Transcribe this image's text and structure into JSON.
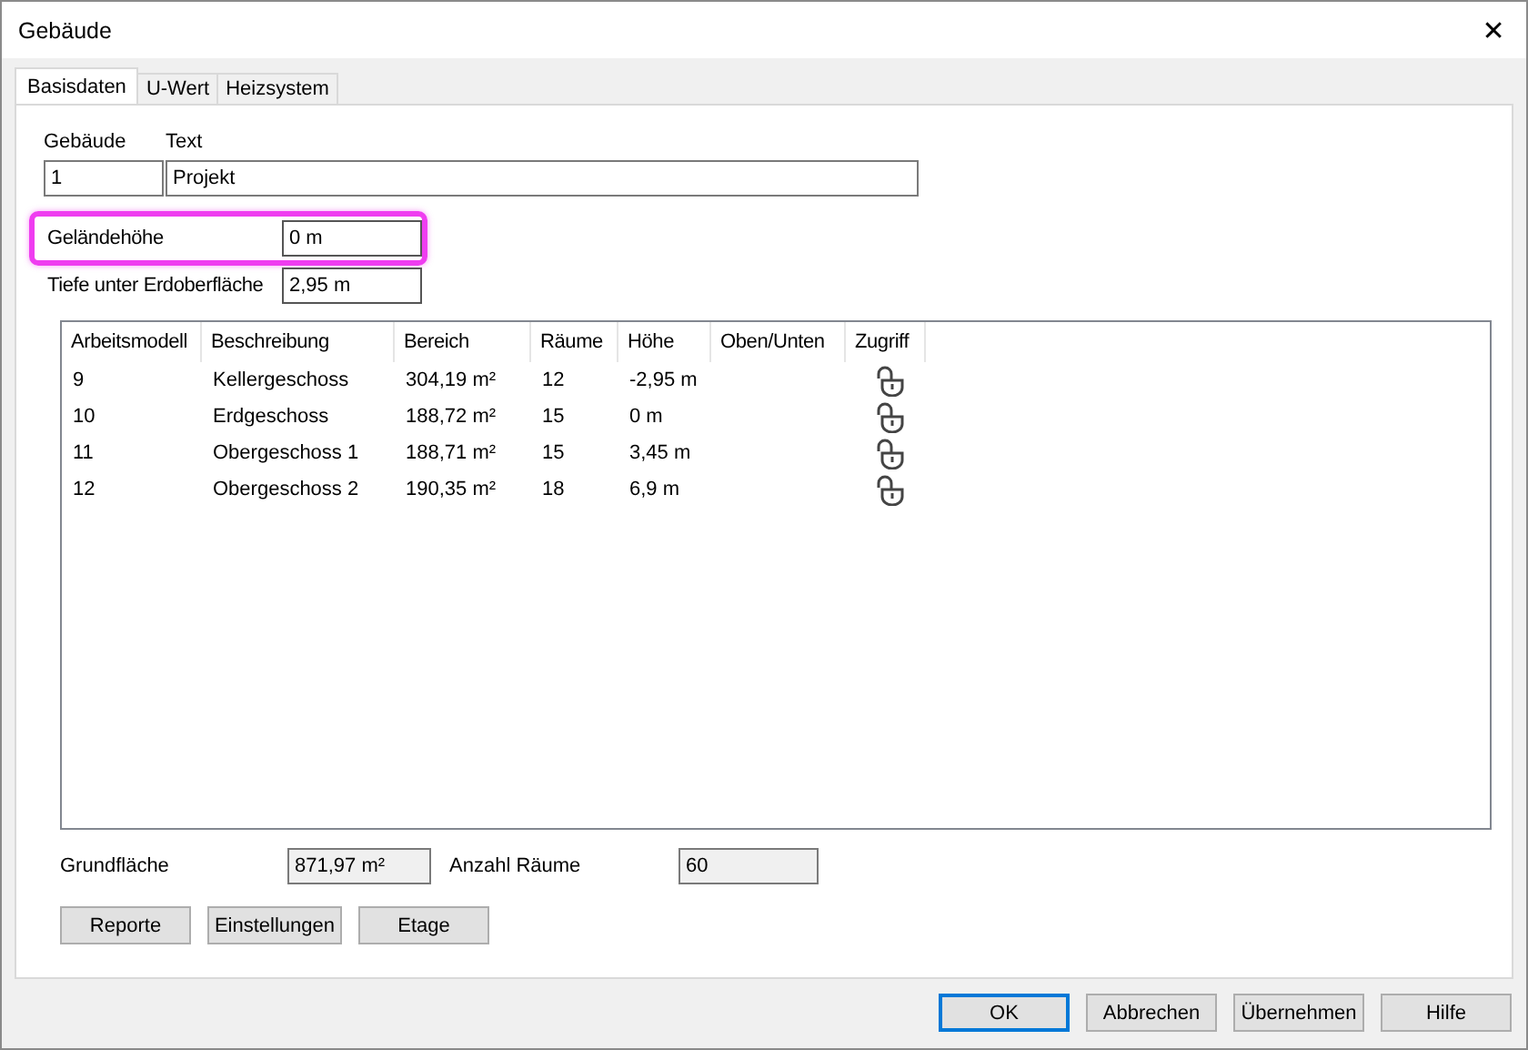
{
  "window": {
    "title": "Gebäude",
    "close": "✕"
  },
  "tabs": [
    {
      "label": "Basisdaten",
      "selected": true
    },
    {
      "label": "U-Wert",
      "selected": false
    },
    {
      "label": "Heizsystem",
      "selected": false
    }
  ],
  "building": {
    "number_label": "Gebäude",
    "number": "1",
    "text_label": "Text",
    "text": "Projekt"
  },
  "terrain_height": {
    "label": "Geländehöhe",
    "value": "0 m",
    "highlighted": true
  },
  "depth": {
    "label": "Tiefe unter Erdoberfläche",
    "value": "2,95 m"
  },
  "table": {
    "columns": [
      "Arbeitsmodell",
      "Beschreibung",
      "Bereich",
      "Räume",
      "Höhe",
      "Oben/Unten",
      "Zugriff"
    ],
    "rows": [
      {
        "model": "9",
        "description": "Kellergeschoss",
        "area": "304,19 m²",
        "rooms": "12",
        "height": "-2,95 m",
        "locked": false
      },
      {
        "model": "10",
        "description": "Erdgeschoss",
        "area": "188,72 m²",
        "rooms": "15",
        "height": "0 m",
        "locked": false
      },
      {
        "model": "11",
        "description": "Obergeschoss 1",
        "area": "188,71 m²",
        "rooms": "15",
        "height": "3,45 m",
        "locked": false
      },
      {
        "model": "12",
        "description": "Obergeschoss 2",
        "area": "190,35 m²",
        "rooms": "18",
        "height": "6,9 m",
        "locked": false
      }
    ]
  },
  "summary": {
    "area_label": "Grundfläche",
    "area": "871,97 m²",
    "rooms_label": "Anzahl Räume",
    "rooms": "60"
  },
  "panel_buttons": [
    "Reporte",
    "Einstellungen",
    "Etage"
  ],
  "dialog_buttons": [
    {
      "label": "OK",
      "default": true
    },
    {
      "label": "Abbrechen",
      "default": false
    },
    {
      "label": "Übernehmen",
      "default": false
    },
    {
      "label": "Hilfe",
      "default": false
    }
  ]
}
